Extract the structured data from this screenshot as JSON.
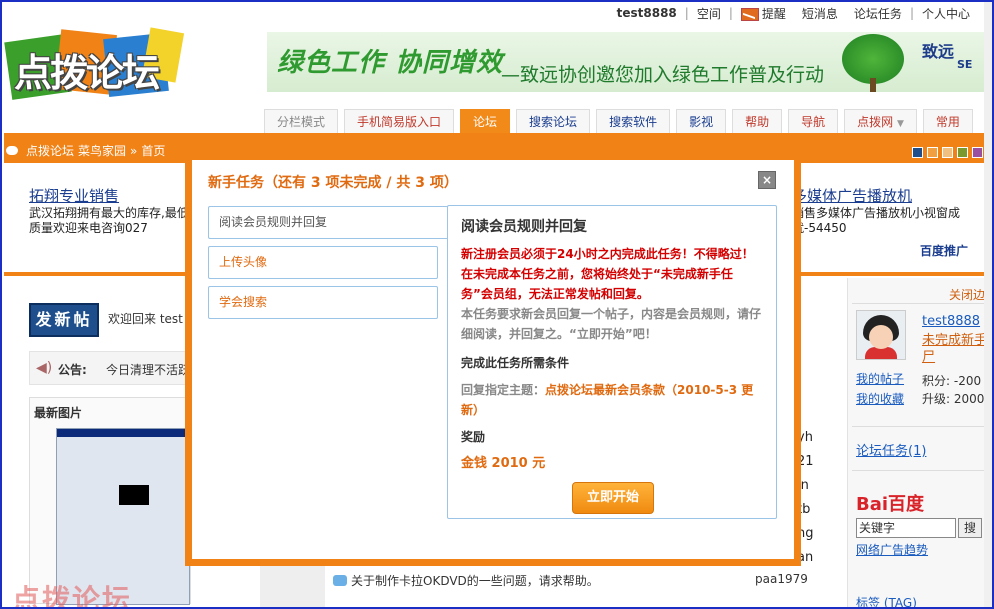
{
  "topbar": {
    "username": "test8888",
    "links": [
      "空间",
      "提醒",
      "短消息",
      "论坛任务",
      "个人中心"
    ]
  },
  "logo": {
    "text": "点拨论坛"
  },
  "banner": {
    "slogan": "绿色工作 协同增效",
    "subline": "—致远协创邀您加入绿色工作普及行动",
    "brand": "致远",
    "brand_sub": "SE"
  },
  "nav": {
    "tabs": [
      "分栏模式",
      "手机简易版入口",
      "论坛",
      "搜索论坛",
      "搜索软件",
      "影视",
      "帮助",
      "导航",
      "点拨网",
      "常用"
    ],
    "active": "论坛"
  },
  "breadcrumb": [
    "点拨论坛",
    "菜鸟家园",
    "»",
    "首页"
  ],
  "swatch_colors": [
    "#1e4f8c",
    "#f0a040",
    "#f0c080",
    "#7a9a30",
    "#9a50a0"
  ],
  "ads": {
    "left": {
      "title": "拓翔专业销售",
      "desc": "武汉拓翔拥有最大的库存,最低的质量欢迎来电咨询027"
    },
    "right": {
      "title": "多媒体广告播放机",
      "desc": "销售多媒体广告播放机小视窗成就-54450",
      "baidu": "百度推广"
    }
  },
  "content": {
    "post_button": "发新帖",
    "welcome": "欢迎回来 test",
    "notice_label": "公告:",
    "notice_text": "今日清理不活跃",
    "latest_images": "最新图片",
    "watermark": "点拨论坛",
    "right_letters": [
      "yh",
      "21",
      "in",
      "tb",
      "ng",
      "an"
    ],
    "last_row": {
      "title": "关于制作卡拉OKDVD的一些问题，请求帮助。",
      "author": "paa1979"
    }
  },
  "sidebar": {
    "close_label": "关闭边",
    "username": "test8888",
    "group": "未完成新手尸",
    "my_posts": "我的帖子",
    "my_favorites": "我的收藏",
    "points": "积分: -200",
    "level": "升级: 2000",
    "tasks": "论坛任务(1)",
    "baidu_logo": "Bai百度",
    "search_placeholder": "关键字",
    "search_button": "搜",
    "trend": "网络广告趋势",
    "bottom": "标签 (TAG)"
  },
  "modal": {
    "title": "新手任务（还有 3 项未完成 / 共 3 项）",
    "close": "×",
    "tabs": [
      "阅读会员规则并回复",
      "上传头像",
      "学会搜索"
    ],
    "active_tab": 0,
    "panel": {
      "heading": "阅读会员规则并回复",
      "warning": "新注册会员必须于24小时之内完成此任务！不得略过！在未完成本任务之前，您将始终处于“未完成新手任务”会员组，无法正常发帖和回复。",
      "desc": "本任务要求新会员回复一个帖子，内容是会员规则，请仔细阅读，并回复之。“立即开始”吧！",
      "conditions_label": "完成此任务所需条件",
      "requirement_prefix": "回复指定主题：",
      "requirement_link": "点拨论坛最新会员条款（2010-5-3 更新）",
      "reward_label": "奖励",
      "reward_value": "金钱  2010 元",
      "start_button": "立即开始"
    }
  }
}
